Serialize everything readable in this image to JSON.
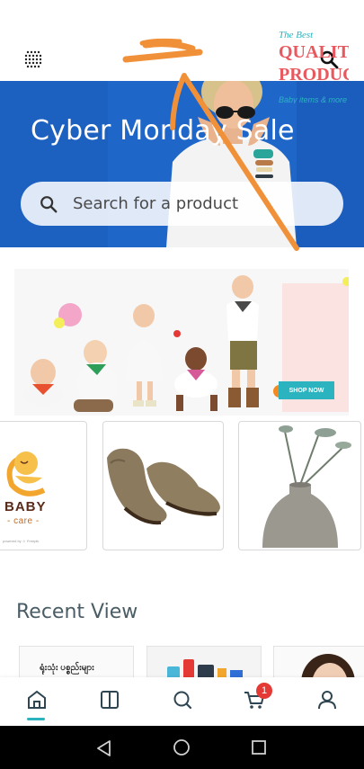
{
  "app": {
    "accent_color": "#2bb4c0",
    "badge_color": "#e53935",
    "overlay_scribble_color": "#f0913a"
  },
  "topbar": {
    "menu_icon": "grid-dots-icon",
    "search_icon": "search-icon"
  },
  "hero": {
    "title": "Cyber Monday Sale",
    "search_placeholder": "Search for a product",
    "background_color": "#1f66c9"
  },
  "promo": {
    "tagline": "The Best",
    "headline_line1": "QUALITY",
    "headline_line2": "PRODUCTS",
    "subline": "Baby items & more",
    "cta": "SHOP NOW"
  },
  "products": [
    {
      "name": "baby-care-logo",
      "brand_word": "BABY",
      "brand_sub": "- care -",
      "tiny": "powered by ☺ Freepik"
    },
    {
      "name": "desert-boots",
      "image": "brown suede shoes"
    },
    {
      "name": "ceramic-vase",
      "image": "gray vase with dried plant"
    }
  ],
  "recent": {
    "title": "Recent View",
    "items": [
      {
        "text": "ရုံးသုံး ပစ္စည်းများ"
      },
      {
        "image": "electronics"
      },
      {
        "image": "portrait"
      }
    ]
  },
  "bottom_nav": {
    "items": [
      {
        "name": "home",
        "icon": "home-icon",
        "active": true
      },
      {
        "name": "categories",
        "icon": "book-icon"
      },
      {
        "name": "search",
        "icon": "search-icon"
      },
      {
        "name": "cart",
        "icon": "cart-icon"
      },
      {
        "name": "account",
        "icon": "user-icon"
      }
    ],
    "cart_count": "1"
  },
  "system_nav": {
    "back_icon": "back-triangle-icon",
    "home_icon": "home-circle-icon",
    "recents_icon": "recents-square-icon"
  }
}
